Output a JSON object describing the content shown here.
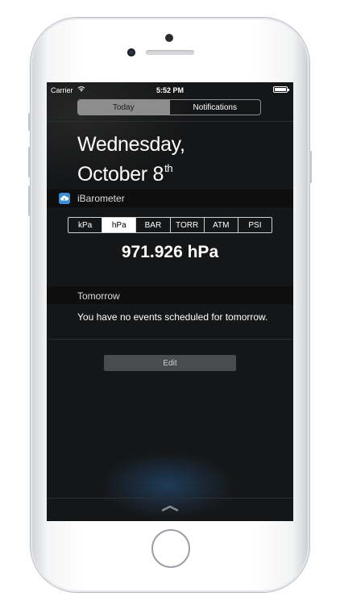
{
  "status_bar": {
    "carrier": "Carrier",
    "time": "5:52 PM"
  },
  "segments": [
    {
      "label": "Today",
      "selected": true
    },
    {
      "label": "Notifications",
      "selected": false
    }
  ],
  "date": {
    "line1": "Wednesday,",
    "line2": "October 8",
    "suffix": "th"
  },
  "widget": {
    "name": "iBarometer",
    "icon": "cloud-icon",
    "icon_color": "#3a8ed6",
    "units": [
      {
        "label": "kPa",
        "selected": false
      },
      {
        "label": "hPa",
        "selected": true
      },
      {
        "label": "BAR",
        "selected": false
      },
      {
        "label": "TORR",
        "selected": false
      },
      {
        "label": "ATM",
        "selected": false
      },
      {
        "label": "PSI",
        "selected": false
      }
    ],
    "reading": "971.926 hPa"
  },
  "tomorrow": {
    "title": "Tomorrow",
    "message": "You have no events scheduled for tomorrow."
  },
  "edit_label": "Edit",
  "colors": {
    "screen_bg": "#151617",
    "segment_active": "#8d8d8d",
    "app_icon": "#3a8ed6"
  }
}
